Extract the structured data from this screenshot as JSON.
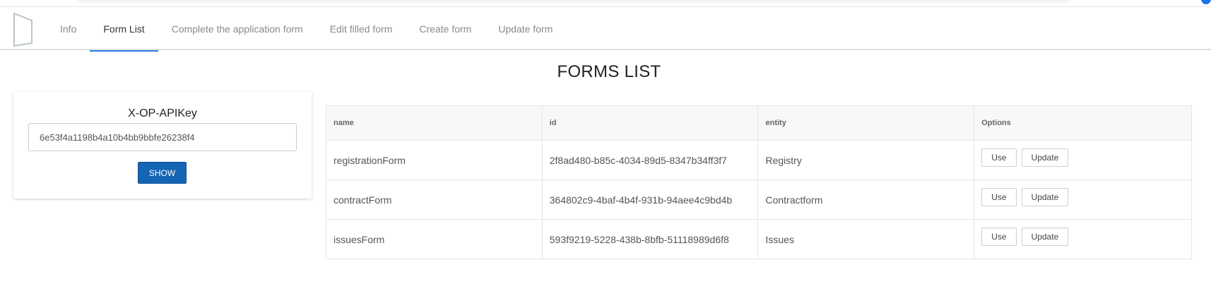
{
  "nav": {
    "tabs": [
      {
        "label": "Info",
        "active": false
      },
      {
        "label": "Form List",
        "active": true
      },
      {
        "label": "Complete the application form",
        "active": false
      },
      {
        "label": "Edit filled form",
        "active": false
      },
      {
        "label": "Create form",
        "active": false
      },
      {
        "label": "Update form",
        "active": false
      }
    ]
  },
  "page": {
    "title": "FORMS LIST"
  },
  "api_key": {
    "label": "X-OP-APIKey",
    "value": "6e53f4a1198b4a10b4bb9bbfe26238f4",
    "button_label": "SHOW"
  },
  "table": {
    "columns": [
      "name",
      "id",
      "entity",
      "Options"
    ],
    "rows": [
      {
        "name": "registrationForm",
        "id": "2f8ad480-b85c-4034-89d5-8347b34ff3f7",
        "entity": "Registry"
      },
      {
        "name": "contractForm",
        "id": "364802c9-4baf-4b4f-931b-94aee4c9bd4b",
        "entity": "Contractform"
      },
      {
        "name": "issuesForm",
        "id": "593f9219-5228-438b-8bfb-51118989d6f8",
        "entity": "Issues"
      }
    ],
    "use_label": "Use",
    "update_label": "Update"
  },
  "colors": {
    "accent": "#2a7ae2",
    "primary_button": "#1565b5"
  }
}
